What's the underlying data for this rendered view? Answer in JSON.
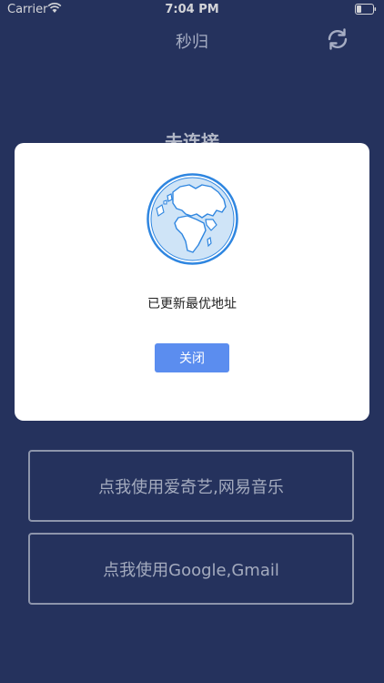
{
  "status_bar": {
    "carrier": "Carrier",
    "time": "7:04 PM"
  },
  "nav": {
    "title": "秒归",
    "refresh_icon": "refresh-icon"
  },
  "connection": {
    "status": "未连接"
  },
  "buttons": [
    {
      "label": "点我使用爱奇艺,网易音乐"
    },
    {
      "label": "点我使用Google,Gmail"
    }
  ],
  "dialog": {
    "icon": "globe-icon",
    "message": "已更新最优地址",
    "close_label": "关闭"
  },
  "colors": {
    "background": "#2b3a69",
    "accent": "#5b8def",
    "globe_blue": "#2f86e0"
  }
}
